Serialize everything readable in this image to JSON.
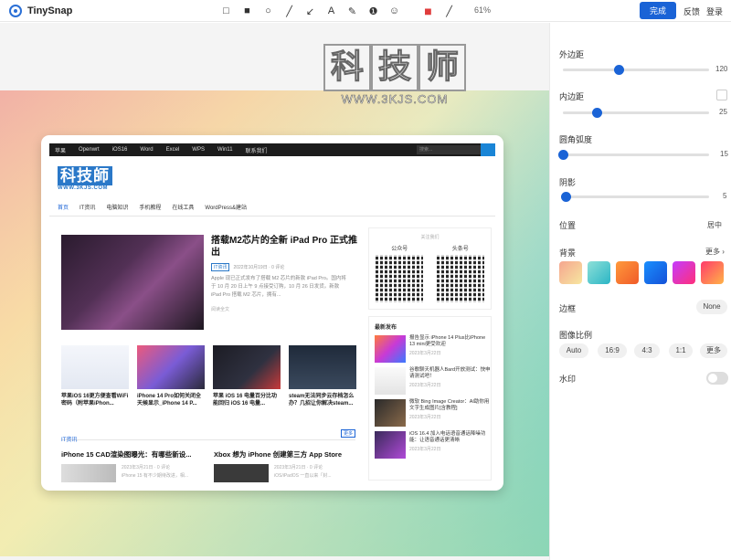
{
  "app": {
    "title": "TinySnap"
  },
  "toolbar": {
    "zoom": "61%",
    "done_label": "完成",
    "feedback_label": "反馈",
    "login_label": "登录",
    "tool_glyphs": {
      "rect_outline": "□",
      "rect_filled": "■",
      "circle": "○",
      "line": "╱",
      "arrow": "↙",
      "text": "A",
      "pen": "✎",
      "step": "❶",
      "emoji": "☺",
      "color": "■",
      "stroke": "╱"
    },
    "accent_color": "#1a63d6",
    "current_color": "#e03c3c"
  },
  "watermark": {
    "chars": [
      "科",
      "技",
      "师"
    ],
    "url": "WWW.3KJS.COM"
  },
  "site": {
    "nav": [
      "苹果",
      "Openwrt",
      "iOS16",
      "Word",
      "Excel",
      "WPS",
      "Win11",
      "联系我们"
    ],
    "search_placeholder": "搜索...",
    "logo_text": "科技師",
    "logo_url": "WWW.3KJS.COM",
    "menu": [
      "首页",
      "IT资讯",
      "电脑知识",
      "手机教程",
      "在线工具",
      "WordPress&建站"
    ],
    "feature": {
      "title": "搭载M2芯片的全新 iPad Pro 正式推出",
      "tag": "IT资讯",
      "meta": "2022年10月19日 · 0 评论",
      "desc": "Apple 现已正式发布了搭载 M2 芯片的新款 iPad Pro。国内将于 10 月 20 日上午 9 点接受订购，10 月 26 日发货。新款 iPad Pro 搭载 M2 芯片，拥有...",
      "more": "阅读全文"
    },
    "thumbs": [
      "苹果iOS 16更方便查看WiFi密码（附苹果iPhon...",
      "iPhone 14 Pro如何关闭全天候显示_iPhone 14 P...",
      "苹果 iOS 16 电量百分比功能回归 iOS 16 电量...",
      "steam无法同步云存档怎么办？几招让你解决steam..."
    ],
    "section": {
      "title": "IT资讯",
      "more": "更多"
    },
    "bottom_articles": [
      {
        "title": "iPhone 15 CAD渲染图曝光：有哪些新设...",
        "meta": "2023年3月21日 · 0 评论",
        "snippet": "iPhone 15 有不少期待改进，相..."
      },
      {
        "title": "Xbox 想为 iPhone 创建第三方 App Store",
        "meta": "2023年3月21日 · 0 评论",
        "snippet": "iOS/iPadOS 一直以来「封..."
      }
    ],
    "qr": {
      "top": "关注我们",
      "labels": [
        "公众号",
        "头条号"
      ]
    },
    "news": {
      "title": "最新发布",
      "items": [
        {
          "head": "报告显示 iPhone 14 Plus比iPhone 13 mini更受欢迎",
          "date": "2023年3月22日"
        },
        {
          "head": "谷歌聊天机器人Bard开放测试：快申请测试吧！",
          "date": "2023年3月22日"
        },
        {
          "head": "微软 Bing Image Creator：AI助你用文字生成图片[含教程]",
          "date": "2023年3月22日"
        },
        {
          "head": "iOS 16.4 加入电话语音通话降噪功能：让语音通话更清晰",
          "date": "2023年3月22日"
        }
      ]
    }
  },
  "panel": {
    "outer_margin": {
      "label": "外边距",
      "value": "120",
      "level": 0.38
    },
    "inner_padding": {
      "label": "内边距",
      "value": "25",
      "level": 0.23
    },
    "corner_radius": {
      "label": "圆角弧度",
      "value": "15",
      "level": 0.0
    },
    "shadow": {
      "label": "阴影",
      "value": "5",
      "level": 0.02
    },
    "position": {
      "label": "位置",
      "value": "居中"
    },
    "background": {
      "label": "背景",
      "more": "更多 ›",
      "swatches": [
        [
          "#f5a58f",
          "#f7e7a0"
        ],
        [
          "#8ee0d8",
          "#2bb5c5"
        ],
        [
          "#ff9a3c",
          "#f05a28"
        ],
        [
          "#1a8ffe",
          "#1451d8"
        ],
        [
          "#c43cff",
          "#ff2f7a"
        ],
        [
          "#ff3b6b",
          "#ffb347"
        ]
      ]
    },
    "border": {
      "label": "边框",
      "value": "None"
    },
    "ratio": {
      "label": "图像比例",
      "options": [
        "Auto",
        "16:9",
        "4:3",
        "1:1",
        "更多"
      ]
    },
    "watermark_toggle": {
      "label": "水印",
      "on": false
    }
  }
}
